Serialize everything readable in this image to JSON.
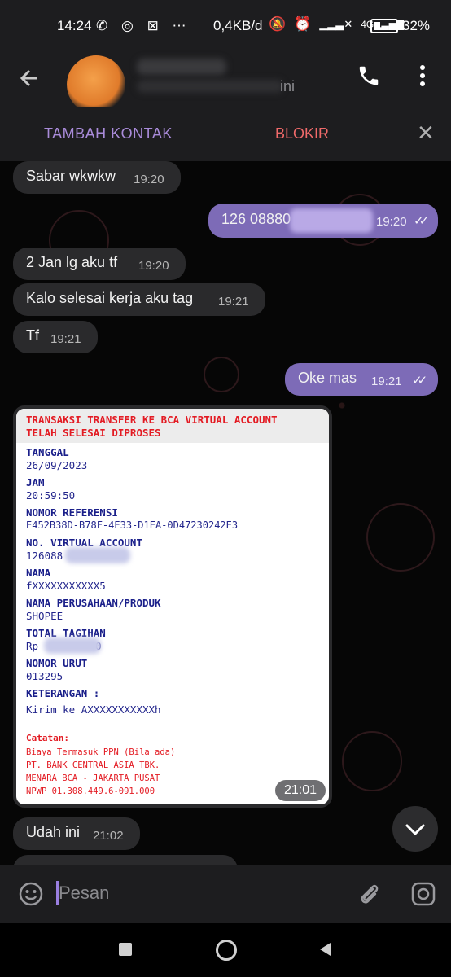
{
  "status_bar": {
    "time": "14:24",
    "left_icons": [
      "whatsapp-icon",
      "instagram-icon",
      "capcut-icon",
      "more-dots-icon"
    ],
    "net_speed": "0,4KB/d",
    "right_icons": [
      "dnd-icon",
      "alarm-icon",
      "signal-off-icon",
      "signal-4g-icon"
    ],
    "network_type": "4G",
    "battery_level": 0.32,
    "battery_pct": "32%"
  },
  "header": {
    "contact_subtitle_tail": "ini",
    "icons": [
      "back-arrow-icon",
      "phone-icon",
      "more-vert-icon"
    ]
  },
  "contact_actions": {
    "add_contact": "TAMBAH KONTAK",
    "block": "BLOKIR"
  },
  "messages": [
    {
      "dir": "in",
      "text": "Sabar wkwkw",
      "time": "19:20"
    },
    {
      "dir": "out",
      "text": "126 08880",
      "time": "19:20",
      "read": true
    },
    {
      "dir": "in",
      "text": "2 Jan lg aku tf",
      "time": "19:20"
    },
    {
      "dir": "in",
      "text": "Kalo selesai kerja aku tag",
      "time": "19:21"
    },
    {
      "dir": "in",
      "text": "Tf",
      "time": "19:21"
    },
    {
      "dir": "out",
      "text": "Oke mas",
      "time": "19:21",
      "read": true
    },
    {
      "dir": "in",
      "text": "Udah ini",
      "time": "21:02"
    }
  ],
  "receipt": {
    "title_line1": "TRANSAKSI TRANSFER KE BCA VIRTUAL ACCOUNT",
    "title_line2": "TELAH SELESAI DIPROSES",
    "fields": [
      {
        "label": "TANGGAL",
        "value": "26/09/2023"
      },
      {
        "label": "JAM",
        "value": "20:59:50"
      },
      {
        "label": "NOMOR REFERENSI",
        "value": "E452B38D-B78F-4E33-D1EA-0D47230242E3"
      },
      {
        "label": "NO. VIRTUAL ACCOUNT",
        "value": "126088"
      },
      {
        "label": "NAMA",
        "value": "fXXXXXXXXXXX5"
      },
      {
        "label": "NAMA PERUSAHAAN/PRODUK",
        "value": "SHOPEE"
      },
      {
        "label": "TOTAL TAGIHAN",
        "value": "Rp"
      },
      {
        "label": "NOMOR URUT",
        "value": "013295"
      },
      {
        "label": "KETERANGAN :",
        "value": "Kirim ke AXXXXXXXXXXXh"
      }
    ],
    "total_tail": "0",
    "notes_heading": "Catatan:",
    "notes": [
      "Biaya Termasuk PPN (Bila ada)",
      "PT. BANK CENTRAL ASIA TBK.",
      "MENARA BCA - JAKARTA PUSAT",
      "NPWP 01.308.449.6-091.000"
    ],
    "time": "21:01"
  },
  "composer": {
    "placeholder": "Pesan",
    "icons": [
      "emoji-icon",
      "attach-icon",
      "camera-icon"
    ]
  },
  "nav": {
    "icons": [
      "recents-square-icon",
      "home-circle-icon",
      "back-triangle-icon"
    ]
  }
}
